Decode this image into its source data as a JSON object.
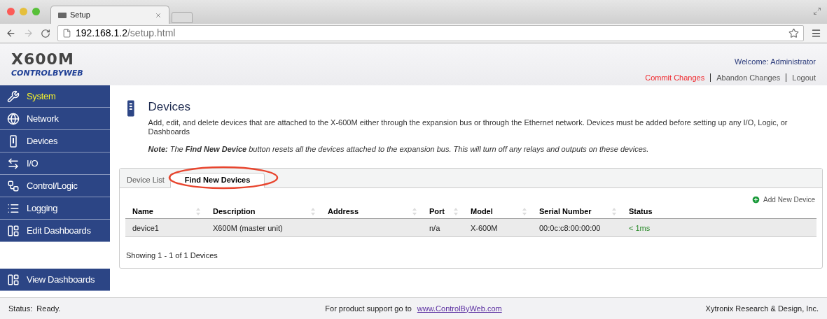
{
  "browser": {
    "tab_title": "Setup",
    "url_host": "192.168.1.2",
    "url_path": "/setup.html"
  },
  "header": {
    "logo_main": "X600M",
    "logo_sub": "CONTROLBYWEB",
    "welcome": "Welcome: Administrator",
    "links": [
      {
        "label": "Commit Changes",
        "kind": "alert"
      },
      {
        "label": "Abandon Changes",
        "kind": "normal"
      },
      {
        "label": "Logout",
        "kind": "normal"
      }
    ]
  },
  "sidebar": {
    "items": [
      {
        "label": "System",
        "selected": true
      },
      {
        "label": "Network",
        "selected": false
      },
      {
        "label": "Devices",
        "selected": false
      },
      {
        "label": "I/O",
        "selected": false
      },
      {
        "label": "Control/Logic",
        "selected": false
      },
      {
        "label": "Logging",
        "selected": false
      },
      {
        "label": "Edit Dashboards",
        "selected": false
      }
    ],
    "bottom_item": {
      "label": "View Dashboards",
      "selected": false
    }
  },
  "page": {
    "title": "Devices",
    "description": "Add, edit, and delete devices that are attached to the X-600M either through the expansion bus or through the Ethernet network. Devices must be added before setting up any I/O, Logic, or Dashboards",
    "note": "**Note:** The **Find New Device** button resets all the devices attached to the expansion bus. This will turn off any relays and outputs on these devices.",
    "tabs": [
      {
        "label": "Device List",
        "selected": false
      },
      {
        "label": "Find New Devices",
        "selected": true
      }
    ],
    "add_button": "Add New Device",
    "table": {
      "columns": [
        {
          "label": "Name",
          "sortable": true
        },
        {
          "label": "Description",
          "sortable": true
        },
        {
          "label": "Address",
          "sortable": true
        },
        {
          "label": "Port",
          "sortable": true
        },
        {
          "label": "Model",
          "sortable": true
        },
        {
          "label": "Serial Number",
          "sortable": true
        },
        {
          "label": "Status",
          "sortable": false
        }
      ],
      "rows": [
        {
          "cells": [
            "device1",
            "X600M (master unit)",
            "",
            "n/a",
            "X-600M",
            "00:0c:c8:00:00:00",
            "< 1ms"
          ]
        }
      ]
    },
    "footer": "Showing 1 - 1 of 1 Devices"
  },
  "status_bar": {
    "status": "Status:  Ready.",
    "support_text": "For product support go to",
    "support_link": "www.ControlByWeb.com",
    "company": "Xytronix Research & Design, Inc."
  }
}
